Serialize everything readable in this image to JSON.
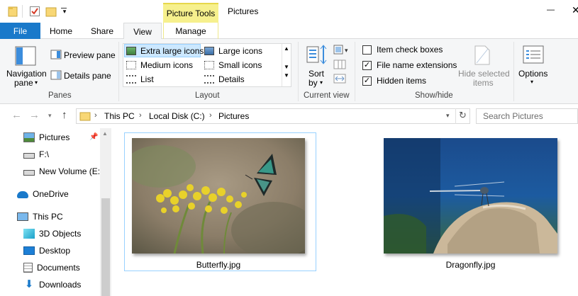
{
  "titlebar": {
    "context_tab_label": "Picture Tools",
    "window_title": "Pictures",
    "minimize_glyph": "—",
    "close_glyph": "✕"
  },
  "tabs": {
    "file": "File",
    "home": "Home",
    "share": "Share",
    "view": "View",
    "manage": "Manage"
  },
  "ribbon": {
    "panes": {
      "navigation_pane_line1": "Navigation",
      "navigation_pane_line2": "pane",
      "preview_pane": "Preview pane",
      "details_pane": "Details pane",
      "group_label": "Panes"
    },
    "layout": {
      "items": [
        "Extra large icons",
        "Large icons",
        "Medium icons",
        "Small icons",
        "List",
        "Details"
      ],
      "selected": "Extra large icons",
      "group_label": "Layout"
    },
    "current_view": {
      "sort_by_line1": "Sort",
      "sort_by_line2": "by",
      "group_label": "Current view"
    },
    "show_hide": {
      "item_check_boxes": {
        "label": "Item check boxes",
        "checked": false
      },
      "file_name_extensions": {
        "label": "File name extensions",
        "checked": true
      },
      "hidden_items": {
        "label": "Hidden items",
        "checked": true
      },
      "hide_selected_line1": "Hide selected",
      "hide_selected_line2": "items",
      "group_label": "Show/hide"
    },
    "options": {
      "label": "Options"
    }
  },
  "address": {
    "crumbs": [
      "This PC",
      "Local Disk (C:)",
      "Pictures"
    ],
    "search_placeholder": "Search Pictures"
  },
  "nav_pane": {
    "items": [
      {
        "label": "Pictures",
        "icon": "pictures-icon",
        "pinned": true
      },
      {
        "label": "F:\\",
        "icon": "drive-icon"
      },
      {
        "label": "New Volume (E:)",
        "icon": "drive-icon"
      },
      {
        "label": "OneDrive",
        "icon": "onedrive-icon"
      },
      {
        "label": "This PC",
        "icon": "this-pc-icon"
      },
      {
        "label": "3D Objects",
        "icon": "3d-objects-icon"
      },
      {
        "label": "Desktop",
        "icon": "desktop-icon"
      },
      {
        "label": "Documents",
        "icon": "documents-icon"
      },
      {
        "label": "Downloads",
        "icon": "downloads-icon"
      }
    ]
  },
  "files": [
    {
      "name": "Butterfly.jpg",
      "selected": true
    },
    {
      "name": "Dragonfly.jpg",
      "selected": false
    }
  ],
  "colors": {
    "accent": "#1979ca",
    "context_tab": "#f6f08d",
    "selection": "#cce8ff",
    "folder": "#f8d775"
  }
}
